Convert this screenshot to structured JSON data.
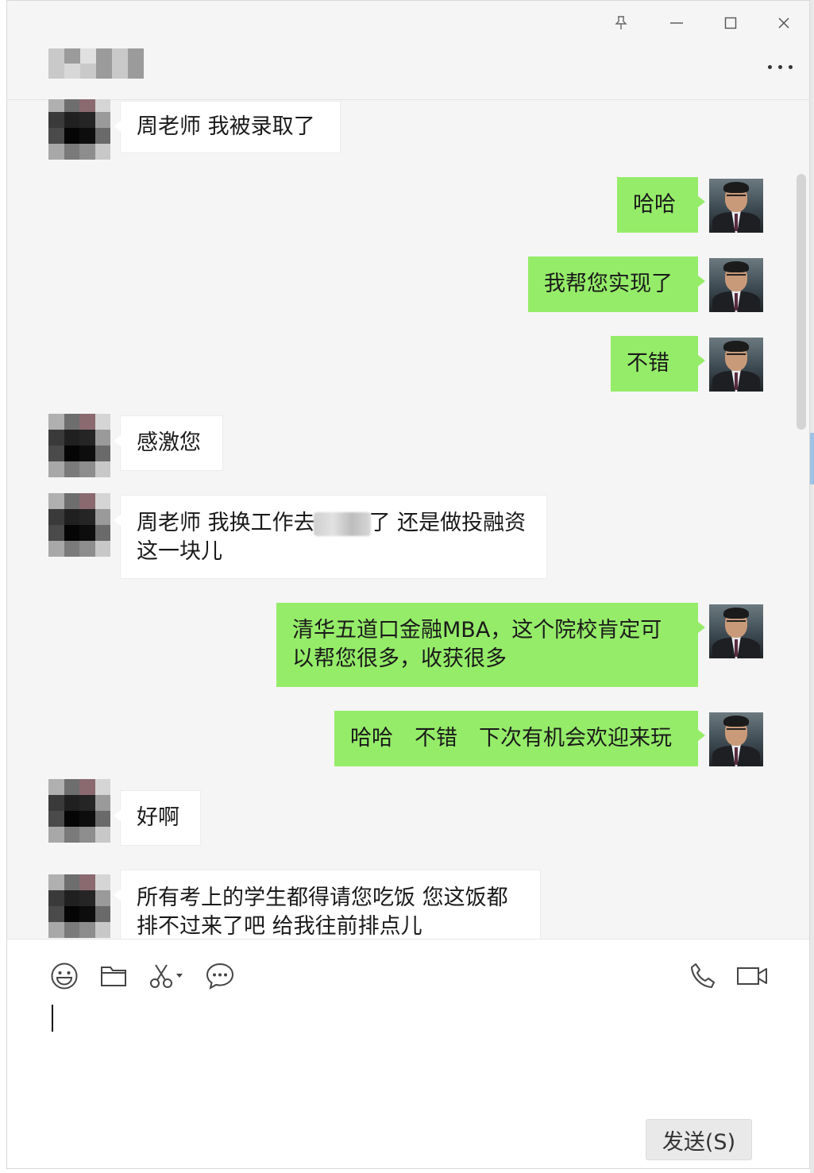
{
  "window": {
    "contact_name": "",
    "more_label": "..."
  },
  "messages": [
    {
      "side": "left",
      "text": "周老师 我被录取了"
    },
    {
      "side": "right",
      "text": "哈哈"
    },
    {
      "side": "right",
      "text": "我帮您实现了"
    },
    {
      "side": "right",
      "text": "不错"
    },
    {
      "side": "left",
      "text": "感激您"
    },
    {
      "side": "left",
      "text_before": "周老师 我换工作去",
      "text_after": "了 还是做投融资",
      "text_line2": "这一块儿"
    },
    {
      "side": "right",
      "text_line1": "清华五道口金融MBA，这个院校肯定可",
      "text_line2": "以帮您很多，收获很多"
    },
    {
      "side": "right",
      "text": "哈哈　不错　下次有机会欢迎来玩"
    },
    {
      "side": "left",
      "text": "好啊"
    },
    {
      "side": "left",
      "text_line1": "所有考上的学生都得请您吃饭 您这饭都",
      "text_line2": "排不过来了吧 给我往前排点儿"
    }
  ],
  "toolbar": {
    "icons": [
      "emoji-icon",
      "folder-icon",
      "scissors-icon",
      "chat-bubble-icon",
      "phone-icon",
      "video-icon"
    ]
  },
  "input": {
    "value": ""
  },
  "send_button": {
    "label": "发送(S)"
  }
}
